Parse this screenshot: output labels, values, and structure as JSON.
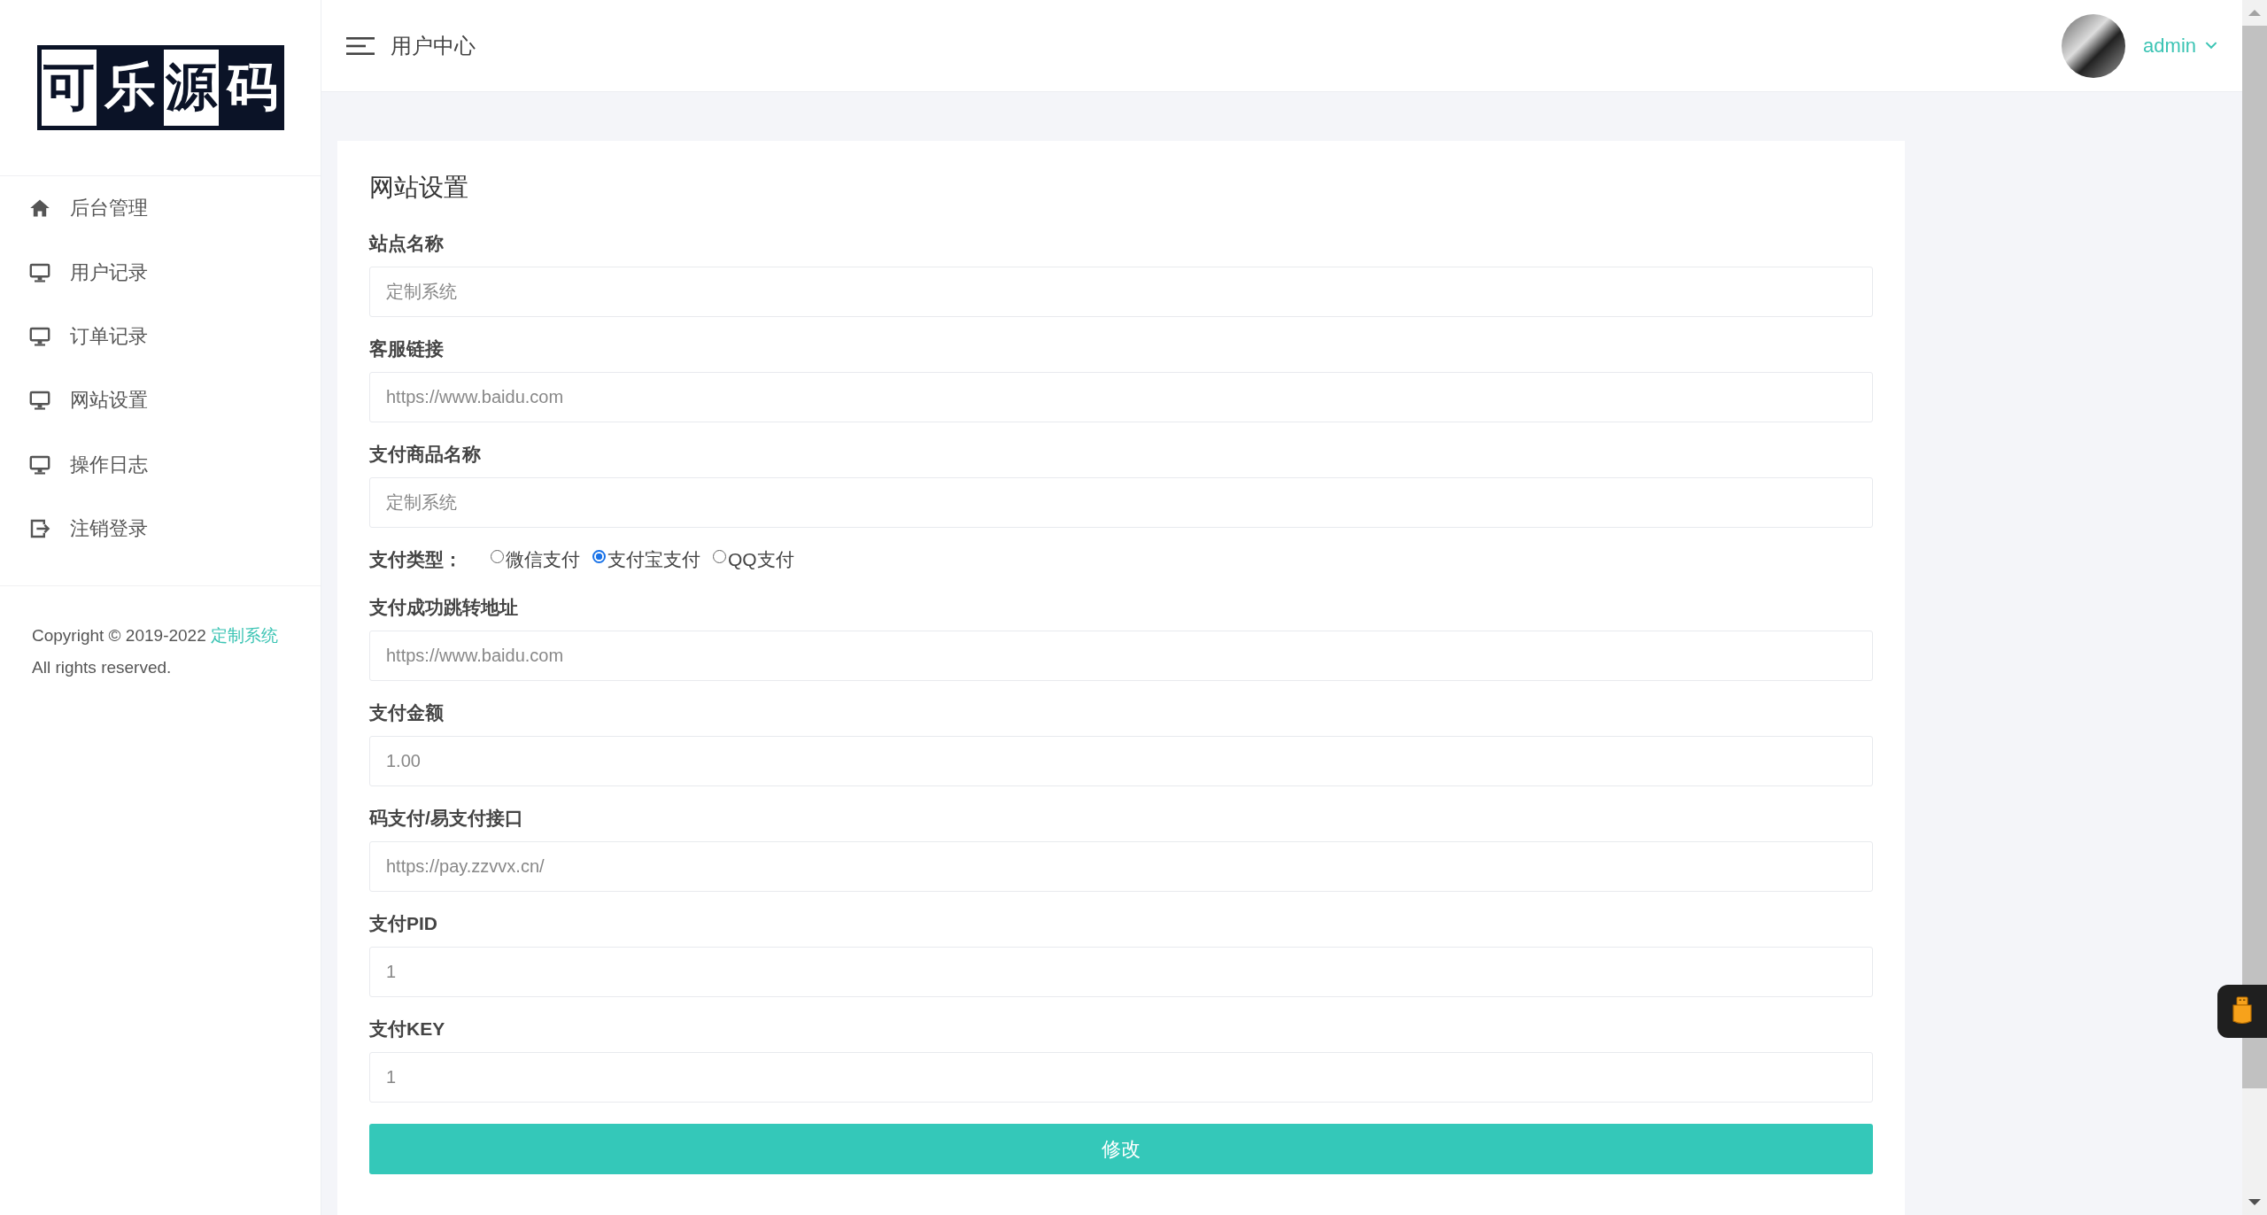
{
  "logo": {
    "characters": [
      {
        "char": "可",
        "inverted": false
      },
      {
        "char": "乐",
        "inverted": true
      },
      {
        "char": "源",
        "inverted": false
      },
      {
        "char": "码",
        "inverted": true
      }
    ]
  },
  "sidebar": {
    "items": [
      {
        "label": "后台管理",
        "kind": "home"
      },
      {
        "label": "用户记录",
        "kind": "monitor"
      },
      {
        "label": "订单记录",
        "kind": "monitor"
      },
      {
        "label": "网站设置",
        "kind": "monitor"
      },
      {
        "label": "操作日志",
        "kind": "monitor"
      },
      {
        "label": "注销登录",
        "kind": "logout"
      }
    ],
    "copyright": {
      "text": "Copyright © 2019-2022",
      "link": "定制系统",
      "suffix": "All rights reserved."
    }
  },
  "header": {
    "title": "用户中心",
    "user": "admin"
  },
  "form": {
    "title": "网站设置",
    "fields": [
      {
        "label": "站点名称",
        "placeholder": "定制系统",
        "kind": "text"
      },
      {
        "label": "客服链接",
        "placeholder": "https://www.baidu.com",
        "kind": "text"
      },
      {
        "label": "支付商品名称",
        "placeholder": "定制系统",
        "kind": "text"
      },
      {
        "label": "支付类型：",
        "kind": "radio",
        "options": [
          {
            "label": "微信支付",
            "selected": false
          },
          {
            "label": "支付宝支付",
            "selected": true
          },
          {
            "label": "QQ支付",
            "selected": false
          }
        ]
      },
      {
        "label": "支付成功跳转地址",
        "placeholder": "https://www.baidu.com",
        "kind": "text"
      },
      {
        "label": "支付金额",
        "placeholder": "1.00",
        "kind": "text"
      },
      {
        "label": "码支付/易支付接口",
        "placeholder": "https://pay.zzvvx.cn/",
        "kind": "text"
      },
      {
        "label": "支付PID",
        "placeholder": "1",
        "kind": "text"
      },
      {
        "label": "支付KEY",
        "placeholder": "1",
        "kind": "text"
      }
    ],
    "submit": "修改"
  }
}
